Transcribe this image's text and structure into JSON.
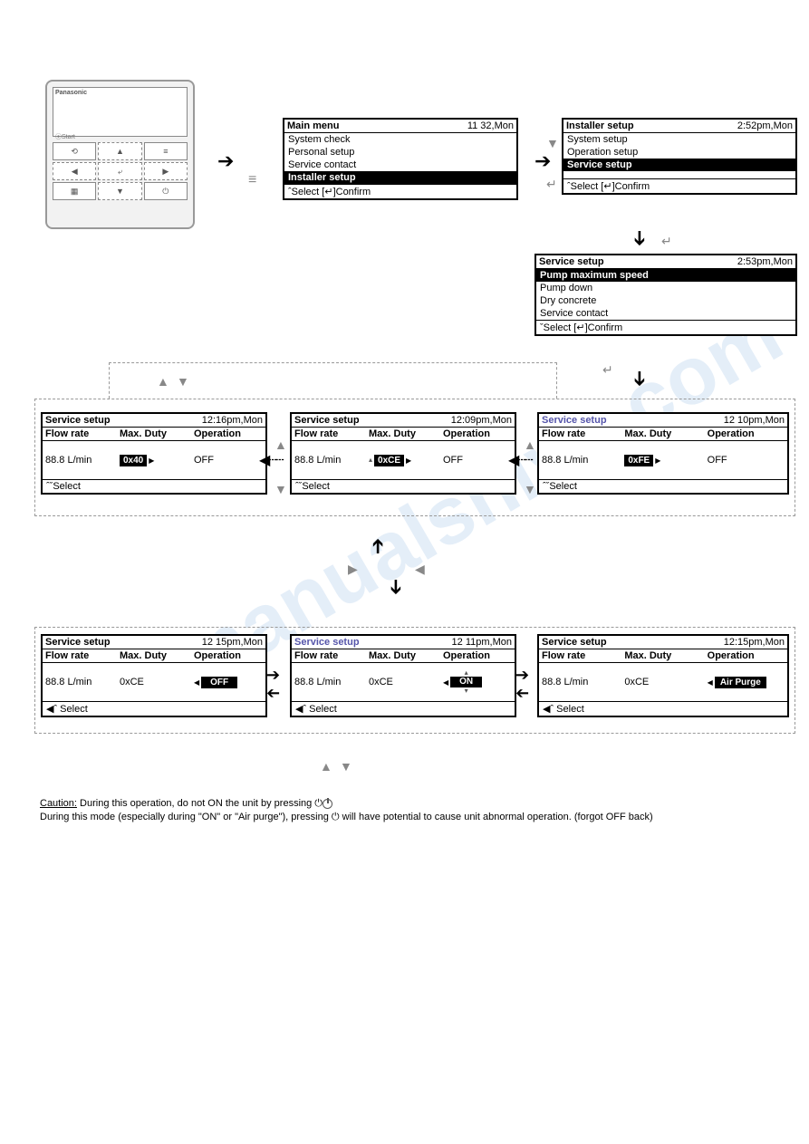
{
  "remote": {
    "brand": "Panasonic",
    "start": "⦿Start",
    "btns": [
      "⟲",
      "▲",
      "≡",
      "◀",
      "⤶",
      "▶",
      "▦",
      "▼",
      "⏻"
    ]
  },
  "mainmenu": {
    "title": "Main menu",
    "time": "11 32,Mon",
    "items": [
      "System check",
      "Personal setup",
      "Service contact",
      "Installer setup"
    ],
    "hl": 3,
    "foot": "ˆSelect        [↵]Confirm"
  },
  "installer": {
    "title": "Installer setup",
    "time": "2:52pm,Mon",
    "items": [
      "System setup",
      "Operation setup",
      "Service setup",
      ""
    ],
    "hl": 2,
    "foot": "ˆSelect        [↵]Confirm"
  },
  "servicemenu": {
    "title": "Service setup",
    "time": "2:53pm,Mon",
    "items": [
      "Pump maximum speed",
      "Pump down",
      "Dry concrete",
      "Service contact"
    ],
    "hl": 0,
    "foot": "ˇSelect       [↵]Confirm"
  },
  "p1": {
    "title": "Service setup",
    "time": "12:16pm,Mon",
    "cols": [
      "Flow rate",
      "Max. Duty",
      "Operation"
    ],
    "v1": "88.8 L/min",
    "v2": "0x40",
    "v3": "OFF",
    "foot": "ˆˇSelect"
  },
  "p2": {
    "title": "Service setup",
    "time": "12:09pm,Mon",
    "cols": [
      "Flow rate",
      "Max. Duty",
      "Operation"
    ],
    "v1": "88.8 L/min",
    "v2": "0xCE",
    "v3": "OFF",
    "foot": "ˆˇSelect"
  },
  "p3": {
    "title": "Service setup",
    "time": "12 10pm,Mon",
    "cols": [
      "Flow rate",
      "Max. Duty",
      "Operation"
    ],
    "v1": "88.8 L/min",
    "v2": "0xFE",
    "v3": "OFF",
    "foot": "ˆˇSelect",
    "titleClass": "title-blue"
  },
  "p4": {
    "title": "Service setup",
    "time": "12 15pm,Mon",
    "cols": [
      "Flow rate",
      "Max. Duty",
      "Operation"
    ],
    "v1": "88.8 L/min",
    "v2": "0xCE",
    "v3": "OFF",
    "foot": "◀ˆ Select"
  },
  "p5": {
    "title": "Service setup",
    "time": "12 11pm,Mon",
    "cols": [
      "Flow rate",
      "Max. Duty",
      "Operation"
    ],
    "v1": "88.8 L/min",
    "v2": "0xCE",
    "v3": "ON",
    "foot": "◀ˆ Select",
    "titleClass": "title-blue"
  },
  "p6": {
    "title": "Service setup",
    "time": "12:15pm,Mon",
    "cols": [
      "Flow rate",
      "Max. Duty",
      "Operation"
    ],
    "v1": "88.8 L/min",
    "v2": "0xCE",
    "v3": "Air Purge",
    "foot": "◀ˆ Select"
  },
  "caution": {
    "u": "Caution:",
    "l1": " During this operation, do not ON the unit by pressing ⏻",
    "l2": " During this mode (especially during \"ON\" or \"Air purge\"), pressing ⏻ will have potential to cause unit abnormal operation. (forgot OFF back)"
  },
  "watermark": "manualshive.com"
}
